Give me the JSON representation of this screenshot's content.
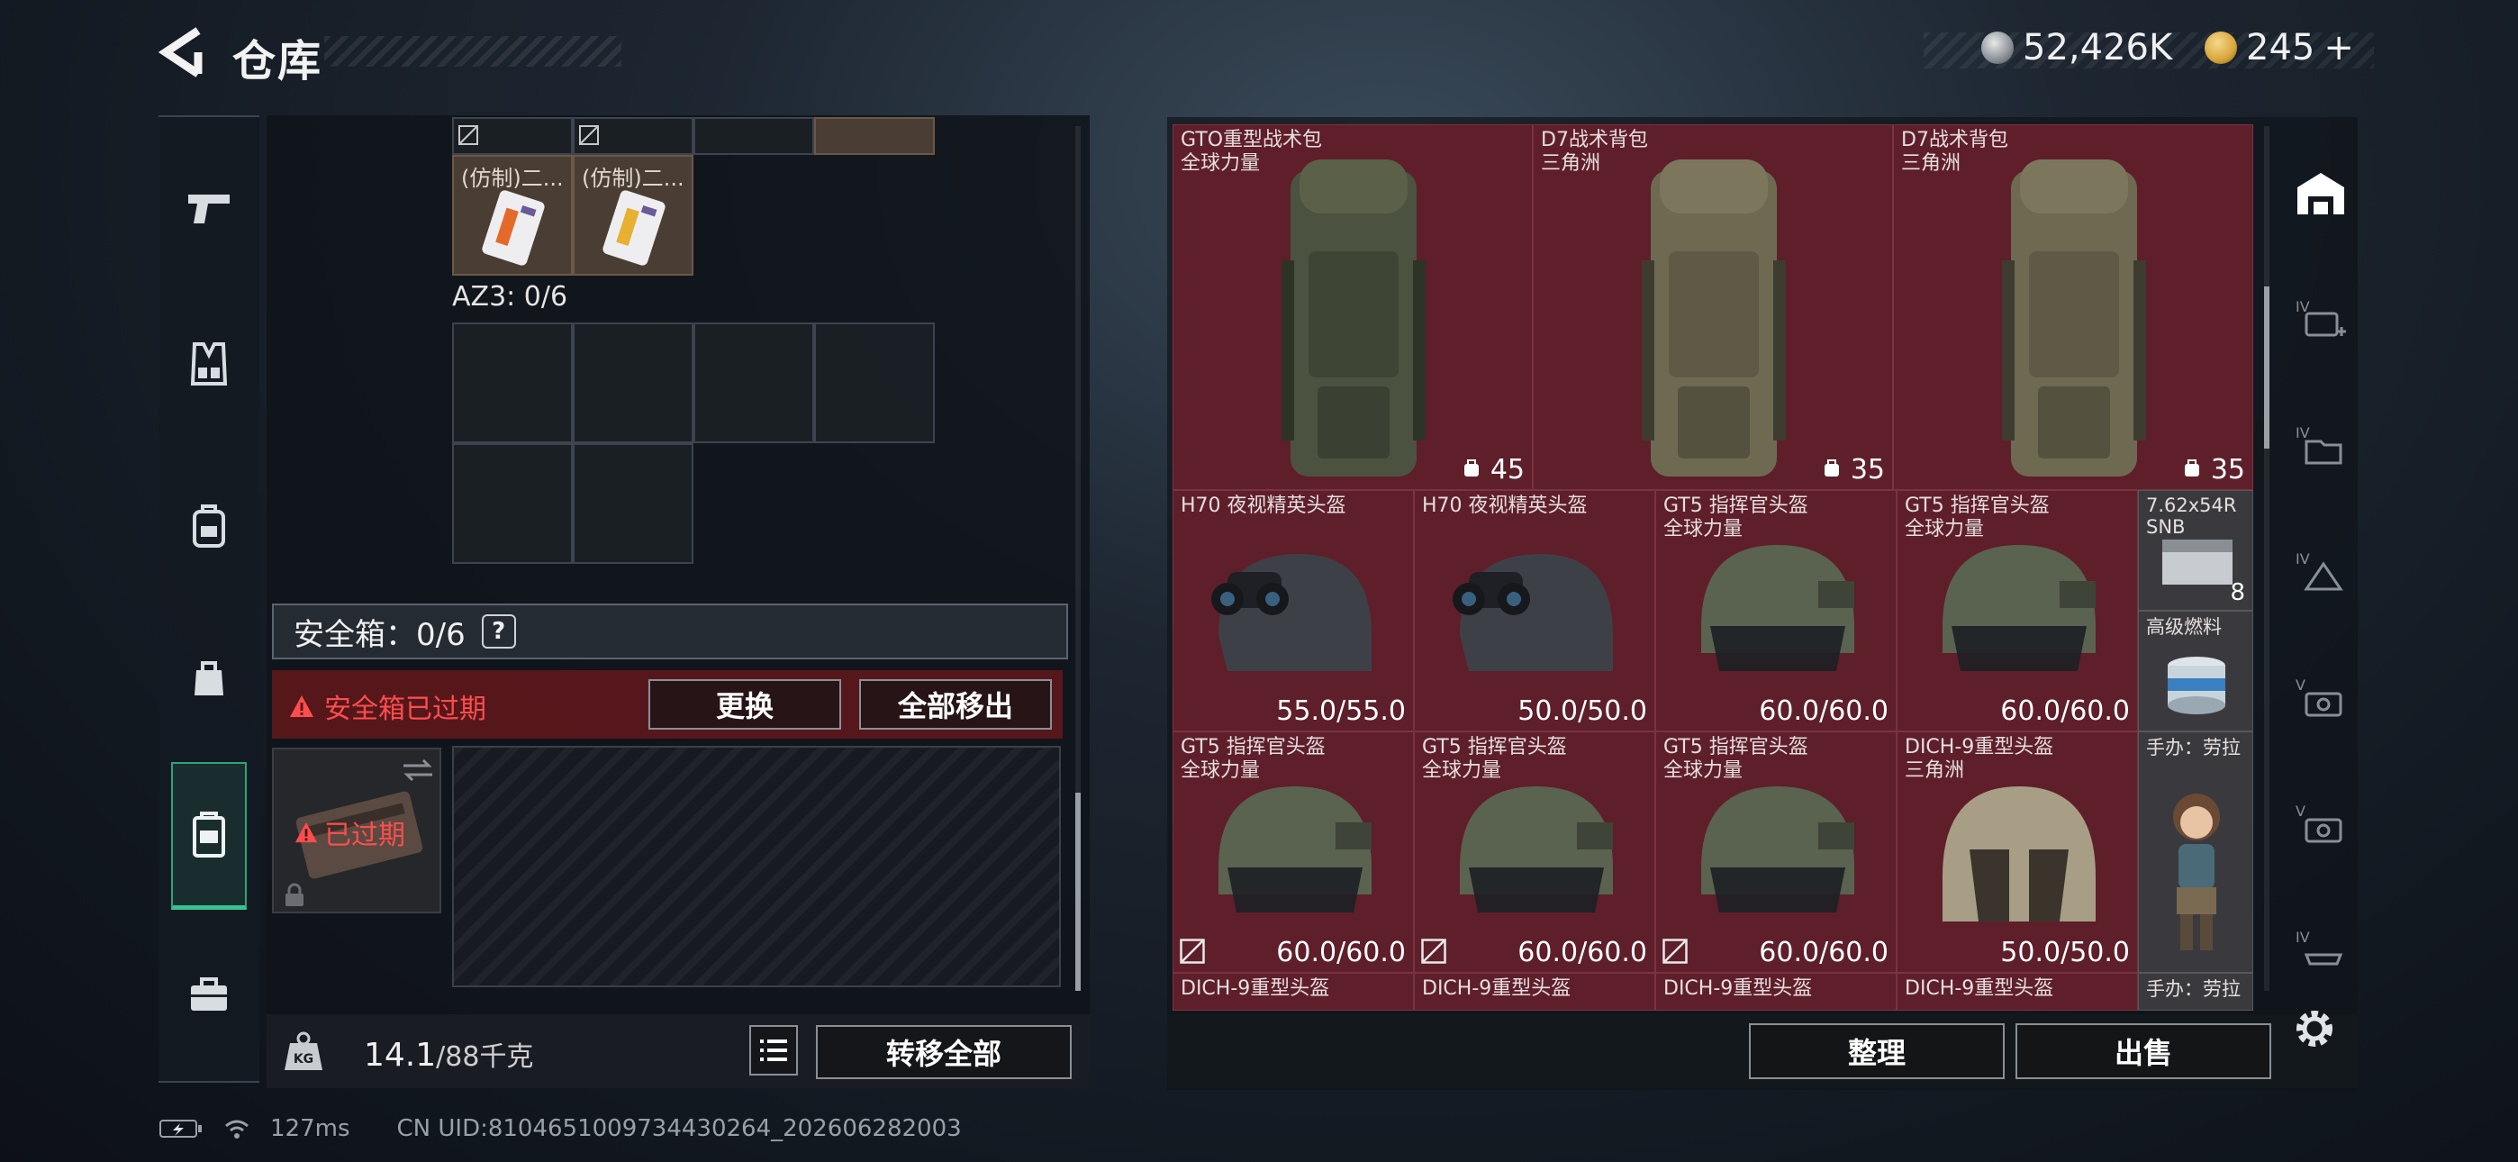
{
  "header": {
    "title": "仓库",
    "currency_silver": "52,426K",
    "currency_gold": "245",
    "gold_plus": "+"
  },
  "left": {
    "case_items": [
      {
        "label": "(仿制)二..."
      },
      {
        "label": "(仿制)二..."
      }
    ],
    "az3_label": "AZ3: 0/6",
    "safebox_label": "安全箱：0/6",
    "safebox_help": "?",
    "expired_notice": "安全箱已过期",
    "replace_button": "更换",
    "remove_all_button": "全部移出",
    "case_expired": "已过期",
    "weight_value": "14.1",
    "weight_unit": "/88千克",
    "transfer_all_button": "转移全部"
  },
  "right": {
    "sort_button": "整理",
    "sell_button": "出售",
    "row1": [
      {
        "name": "GTO重型战术包",
        "sub": "全球力量",
        "value": "45"
      },
      {
        "name": "D7战术背包",
        "sub": "三角洲",
        "value": "35"
      },
      {
        "name": "D7战术背包",
        "sub": "三角洲",
        "value": "35"
      }
    ],
    "row2": [
      {
        "name": "H70 夜视精英头盔",
        "sub": "",
        "value": "55.0/55.0"
      },
      {
        "name": "H70 夜视精英头盔",
        "sub": "",
        "value": "50.0/50.0"
      },
      {
        "name": "GT5 指挥官头盔",
        "sub": "全球力量",
        "value": "60.0/60.0"
      },
      {
        "name": "GT5 指挥官头盔",
        "sub": "全球力量",
        "value": "60.0/60.0"
      }
    ],
    "row3": [
      {
        "name": "GT5 指挥官头盔",
        "sub": "全球力量",
        "value": "60.0/60.0"
      },
      {
        "name": "GT5 指挥官头盔",
        "sub": "全球力量",
        "value": "60.0/60.0"
      },
      {
        "name": "GT5 指挥官头盔",
        "sub": "全球力量",
        "value": "60.0/60.0"
      },
      {
        "name": "DICH-9重型头盔",
        "sub": "三角洲",
        "value": "50.0/50.0"
      }
    ],
    "row4": [
      {
        "name": "DICH-9重型头盔"
      },
      {
        "name": "DICH-9重型头盔"
      },
      {
        "name": "DICH-9重型头盔"
      },
      {
        "name": "DICH-9重型头盔"
      }
    ],
    "small_ammo": {
      "name": "7.62x54R",
      "sub": "SNB",
      "value": "8"
    },
    "small_fuel": {
      "name": "高级燃料"
    },
    "small_figure": {
      "name": "手办：劳拉"
    },
    "small_figure2": {
      "name": "手办：劳拉"
    },
    "side_tiers": [
      "IV",
      "IV",
      "IV",
      "V",
      "V",
      "IV"
    ]
  },
  "status": {
    "ping": "127ms",
    "uid": "CN UID:8104651009734430264_202606282003"
  },
  "colors": {
    "accent_green": "#33c48f",
    "cell_red": "#5e1f2a",
    "expired_red": "#ff4d4d",
    "gold": "#d8a63a"
  }
}
